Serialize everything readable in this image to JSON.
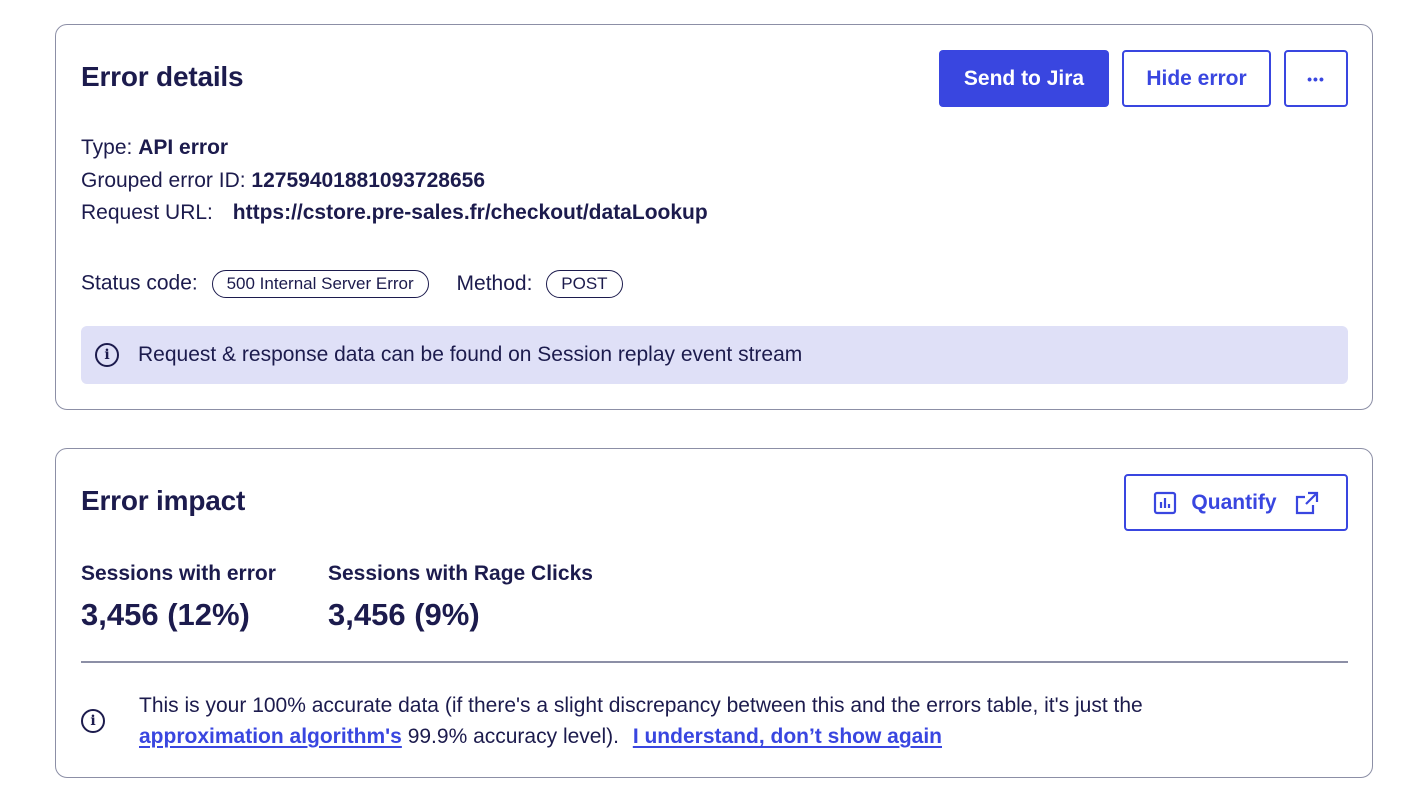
{
  "error_details": {
    "title": "Error details",
    "send_to_jira_label": "Send to Jira",
    "hide_error_label": "Hide error",
    "more_label": "•••",
    "type_label": "Type:",
    "type_value": "API error",
    "grouped_id_label": "Grouped error ID:",
    "grouped_id_value": "1275940188109372865​6",
    "request_url_label": "Request URL:",
    "request_url_value": "https://cstore.pre-sales.fr/checkout/dataLookup",
    "status_code_label": "Status code:",
    "status_code_value": "500 Internal Server Error",
    "method_label": "Method:",
    "method_value": "POST",
    "info_text": "Request & response data can be found on Session replay event stream"
  },
  "error_impact": {
    "title": "Error impact",
    "quantify_label": "Quantify",
    "sessions_error_label": "Sessions with error",
    "sessions_error_value": "3,456 (12%)",
    "sessions_rage_label": "Sessions with Rage Clicks",
    "sessions_rage_value": "3,456 (9%)",
    "note_text_1": "This is your 100% accurate data (if there's a slight discrepancy between this and the errors table, it's just the",
    "note_link_1": "approximation algorithm's",
    "note_text_2": " 99.9% accuracy level).",
    "note_link_2": "I understand, don’t show again"
  },
  "colors": {
    "primary": "#3946e0",
    "text": "#1c1b4d",
    "banner": "#dfe0f7",
    "border": "#8c8fa6"
  }
}
